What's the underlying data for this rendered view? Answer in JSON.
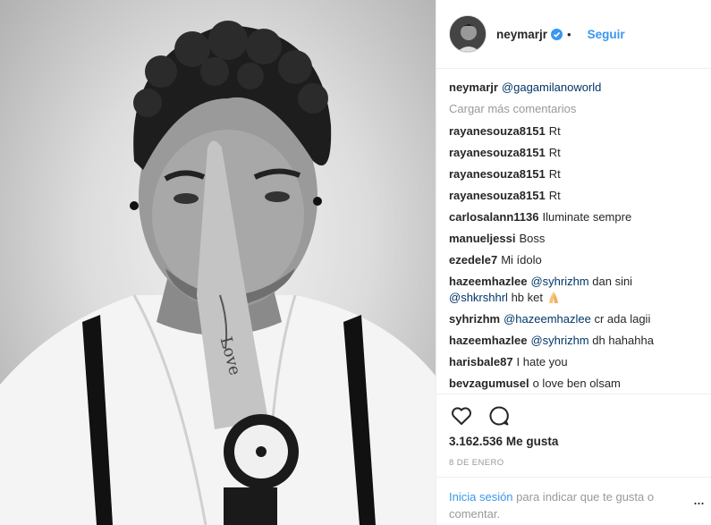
{
  "header": {
    "username": "neymarjr",
    "dot": "•",
    "follow_label": "Seguir"
  },
  "caption": {
    "username": "neymarjr",
    "mention": "@gagamilanoworld"
  },
  "load_more_label": "Cargar más comentarios",
  "comments": [
    {
      "user": "rayanesouza8151",
      "text": "Rt"
    },
    {
      "user": "rayanesouza8151",
      "text": "Rt"
    },
    {
      "user": "rayanesouza8151",
      "text": "Rt"
    },
    {
      "user": "rayanesouza8151",
      "text": "Rt"
    },
    {
      "user": "carlosalann1136",
      "text": "Iluminate sempre"
    },
    {
      "user": "manueljessi",
      "text": "Boss"
    },
    {
      "user": "ezedele7",
      "text": "Mi ídolo"
    },
    {
      "user": "hazeemhazlee",
      "mention": "@syhrizhm",
      "text": "dan sini",
      "mention2": "@shkrshhrl",
      "text2": "hb ket",
      "emoji": "folded-hands-emoji"
    },
    {
      "user": "syhrizhm",
      "mention": "@hazeemhazlee",
      "text": "cr ada lagii"
    },
    {
      "user": "hazeemhazlee",
      "mention": "@syhrizhm",
      "text": "dh hahahha"
    },
    {
      "user": "harisbale87",
      "text": "I hate you"
    },
    {
      "user": "bevzagumusel",
      "text": "o love ben olsam"
    }
  ],
  "actions": {
    "like_icon": "heart-icon",
    "comment_icon": "comment-icon",
    "likes_count": "3.162.536",
    "likes_label": "Me gusta",
    "date": "8 DE ENERO"
  },
  "login_prompt": {
    "link": "Inicia sesión",
    "text": "para indicar que te gusta o comentar.",
    "more": "..."
  },
  "colors": {
    "link_blue": "#3897f0",
    "mention_blue": "#003569",
    "muted_gray": "#999999",
    "text": "#262626"
  }
}
